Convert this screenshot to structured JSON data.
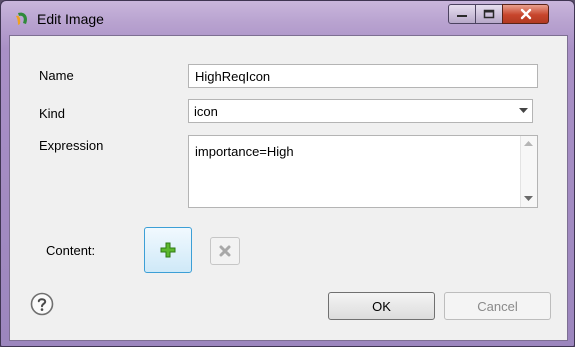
{
  "window": {
    "title": "Edit Image",
    "controls": [
      "minimize",
      "maximize",
      "close"
    ]
  },
  "form": {
    "name": {
      "label": "Name",
      "value": "HighReqIcon"
    },
    "kind": {
      "label": "Kind",
      "value": "icon"
    },
    "expression": {
      "label": "Expression",
      "value": "importance=High"
    },
    "content": {
      "label": "Content:",
      "add_icon": "plus-icon",
      "remove_icon": "x-icon"
    }
  },
  "footer": {
    "help_icon": "help-icon",
    "ok_label": "OK",
    "cancel_label": "Cancel"
  },
  "colors": {
    "titlebar": "#a990c6",
    "close_button": "#c7452c",
    "add_button_border": "#3c9fd6"
  }
}
